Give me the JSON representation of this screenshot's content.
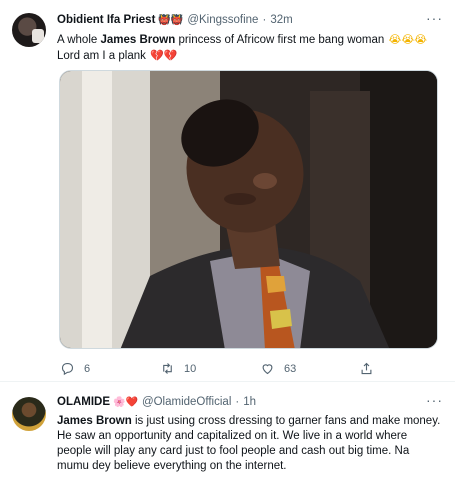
{
  "tweets": [
    {
      "author": "Obidient Ifa Priest",
      "badge": "👹👹",
      "handle": "@Kingssofine",
      "time": "32m",
      "text_pre": "A whole ",
      "text_bold": "James Brown",
      "text_post": " princess of Africow first me bang woman",
      "emoji_crying": "😭😭😭",
      "text_line2": "Lord am I a plank",
      "emoji_broken": "💔💔",
      "replies": "6",
      "retweets": "10",
      "likes": "63"
    },
    {
      "author": "OLAMIDE",
      "badge": "🌸❤️",
      "handle": "@OlamideOfficial",
      "time": "1h",
      "text_bold": "James Brown",
      "text_post": " is just using cross dressing to garner fans and make money. He saw an opportunity and capitalized on it. We live in a world where people will play any card just to fool people and cash out big time. Na mumu dey believe everything on the internet."
    }
  ],
  "separator": "·",
  "more_icon": "···",
  "colors": {
    "muted": "#536471",
    "text": "#0f1419",
    "border": "#eff3f4"
  },
  "icons": [
    "more-icon",
    "reply-icon",
    "retweet-icon",
    "like-icon",
    "share-icon"
  ]
}
